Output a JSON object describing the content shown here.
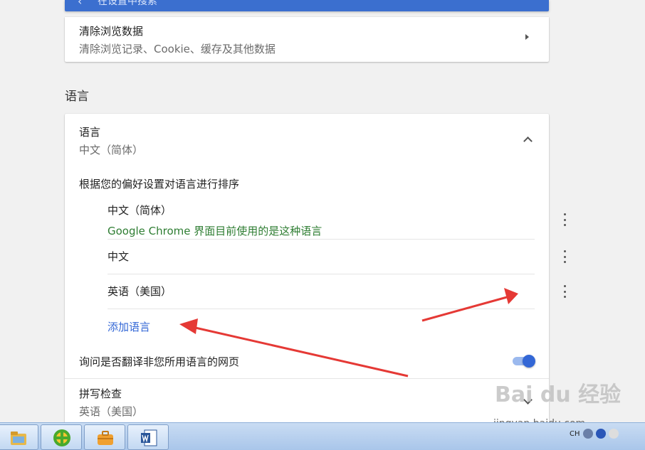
{
  "search": {
    "icon": "back-arrow-icon",
    "text": "在设置中搜索"
  },
  "clear_data": {
    "title": "清除浏览数据",
    "subtitle": "清除浏览记录、Cookie、缓存及其他数据",
    "icon": "chevron-right-icon"
  },
  "section_heading": "语言",
  "language": {
    "title": "语言",
    "subtitle": "中文（简体）",
    "order_label": "根据您的偏好设置对语言进行排序",
    "items": [
      {
        "name": "中文（简体）",
        "note": "Google Chrome 界面目前使用的是这种语言",
        "menu_icon": "more-vert-icon"
      },
      {
        "name": "中文",
        "menu_icon": "more-vert-icon"
      },
      {
        "name": "英语（美国）",
        "menu_icon": "more-vert-icon"
      }
    ],
    "add_label": "添加语言",
    "translate_label": "询问是否翻译非您所用语言的网页",
    "translate_enabled": true,
    "spellcheck_title": "拼写检查",
    "spellcheck_subtitle": "英语（美国）"
  },
  "watermark": {
    "logo": "Bai du 经验",
    "url": "jingyan.baidu.com"
  },
  "taskbar": {
    "apps": [
      "file-explorer-icon",
      "360-security-icon",
      "toolbox-icon",
      "word-icon"
    ],
    "tray": {
      "lang": "CH"
    }
  },
  "colors": {
    "accent": "#3367d6",
    "search_bar": "#3b6fcf",
    "note_green": "#2e7d32",
    "annotation_red": "#e53935"
  }
}
